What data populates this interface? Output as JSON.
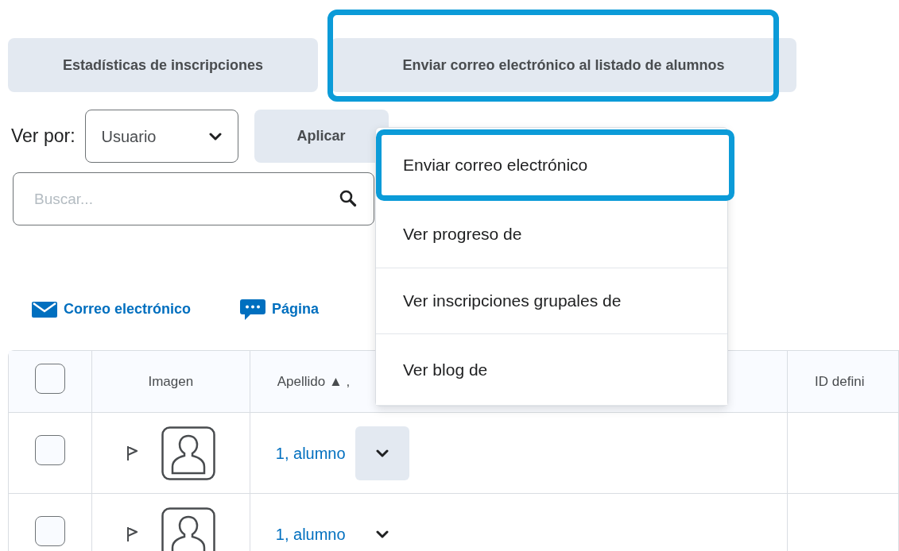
{
  "tabs": [
    {
      "label": "Estadísticas de inscripciones",
      "highlighted": false
    },
    {
      "label": "Enviar correo electrónico al listado de alumnos",
      "highlighted": true
    }
  ],
  "view_by": {
    "label": "Ver por:",
    "value": "Usuario"
  },
  "apply_button": "Aplicar",
  "search": {
    "placeholder": "Buscar..."
  },
  "actions": [
    {
      "label": "Correo electrónico",
      "kind": "mail"
    },
    {
      "label": "Página",
      "kind": "page"
    }
  ],
  "table": {
    "columns": [
      "Imagen",
      "Apellido ▲ ,",
      "ID defini"
    ],
    "header_checked": false,
    "rows": [
      {
        "name": "1, alumno",
        "selected": false,
        "menu_open": true
      },
      {
        "name": "1, alumno",
        "selected": false,
        "menu_open": false
      }
    ]
  },
  "menu": {
    "items": [
      {
        "label": "Enviar correo electrónico",
        "highlighted": true
      },
      {
        "label": "Ver progreso de",
        "highlighted": false
      },
      {
        "label": "Ver inscripciones grupales de",
        "highlighted": false
      },
      {
        "label": "Ver blog de",
        "highlighted": false
      }
    ]
  }
}
